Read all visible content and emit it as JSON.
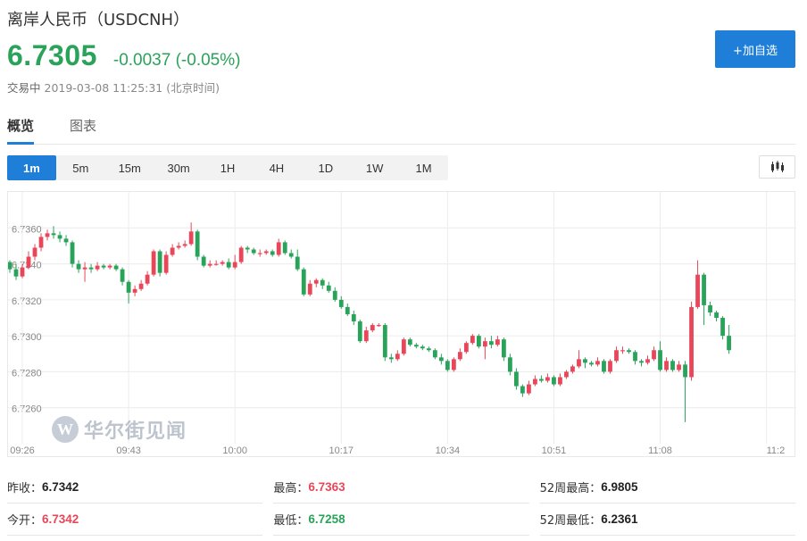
{
  "header": {
    "title": "离岸人民币（USDCNH）",
    "price": "6.7305",
    "change": "-0.0037 (-0.05%)",
    "status": "交易中",
    "timestamp": "2019-03-08 11:25:31 (北京时间)",
    "add_button": "+加自选"
  },
  "tabs": [
    {
      "label": "概览",
      "active": true
    },
    {
      "label": "图表",
      "active": false
    }
  ],
  "periods": [
    {
      "label": "1m",
      "active": true
    },
    {
      "label": "5m",
      "active": false
    },
    {
      "label": "15m",
      "active": false
    },
    {
      "label": "30m",
      "active": false
    },
    {
      "label": "1H",
      "active": false
    },
    {
      "label": "4H",
      "active": false
    },
    {
      "label": "1D",
      "active": false
    },
    {
      "label": "1W",
      "active": false
    },
    {
      "label": "1M",
      "active": false
    }
  ],
  "watermark": {
    "logo": "W",
    "text": "华尔街见闻"
  },
  "colors": {
    "up": "#e8475a",
    "down": "#2aa35a",
    "accent": "#1e7ed8",
    "grid": "#ececec"
  },
  "chart_data": {
    "type": "candlestick",
    "ylim": [
      6.724,
      6.738
    ],
    "y_ticks": [
      "6.7360",
      "6.7340",
      "6.7320",
      "6.7300",
      "6.7280",
      "6.7260"
    ],
    "y_tick_values": [
      6.736,
      6.734,
      6.732,
      6.73,
      6.728,
      6.726
    ],
    "x_ticks": [
      "09:26",
      "09:43",
      "10:00",
      "10:17",
      "10:34",
      "10:51",
      "11:08",
      "11:2"
    ],
    "x_tick_index": [
      2,
      19,
      36,
      53,
      70,
      87,
      104,
      121
    ],
    "grid": true,
    "candles": [
      [
        6.7341,
        6.7337,
        6.7342,
        6.7335
      ],
      [
        6.7337,
        6.7333,
        6.734,
        6.7331
      ],
      [
        6.7333,
        6.7338,
        6.734,
        6.7332
      ],
      [
        6.7338,
        6.7344,
        6.7347,
        6.7337
      ],
      [
        6.7344,
        6.7349,
        6.7351,
        6.7342
      ],
      [
        6.7349,
        6.7355,
        6.7357,
        6.7347
      ],
      [
        6.7355,
        6.7357,
        6.7359,
        6.7353
      ],
      [
        6.7357,
        6.7356,
        6.7361,
        6.7354
      ],
      [
        6.7356,
        6.7354,
        6.7358,
        6.7352
      ],
      [
        6.7354,
        6.7352,
        6.7356,
        6.735
      ],
      [
        6.7352,
        6.734,
        6.7353,
        6.7338
      ],
      [
        6.734,
        6.7337,
        6.7342,
        6.7335
      ],
      [
        6.7337,
        6.7338,
        6.7341,
        6.733
      ],
      [
        6.7338,
        6.7337,
        6.734,
        6.7335
      ],
      [
        6.7337,
        6.7339,
        6.7341,
        6.7336
      ],
      [
        6.7339,
        6.7338,
        6.734,
        6.7337
      ],
      [
        6.7338,
        6.7339,
        6.734,
        6.7337
      ],
      [
        6.7339,
        6.7337,
        6.734,
        6.7336
      ],
      [
        6.7337,
        6.733,
        6.7338,
        6.7328
      ],
      [
        6.733,
        6.7324,
        6.7331,
        6.7318
      ],
      [
        6.7324,
        6.7326,
        6.7328,
        6.7322
      ],
      [
        6.7326,
        6.7329,
        6.7331,
        6.7325
      ],
      [
        6.7329,
        6.7334,
        6.7336,
        6.7328
      ],
      [
        6.7334,
        6.7347,
        6.7348,
        6.7333
      ],
      [
        6.7347,
        6.7335,
        6.7348,
        6.7333
      ],
      [
        6.7335,
        6.7345,
        6.7347,
        6.7334
      ],
      [
        6.7345,
        6.7349,
        6.7351,
        6.7344
      ],
      [
        6.7349,
        6.735,
        6.7352,
        6.7348
      ],
      [
        6.735,
        6.7351,
        6.7353,
        6.7349
      ],
      [
        6.7351,
        6.7358,
        6.7363,
        6.735
      ],
      [
        6.7358,
        6.7344,
        6.7359,
        6.7342
      ],
      [
        6.7344,
        6.7339,
        6.7345,
        6.7338
      ],
      [
        6.7339,
        6.734,
        6.7342,
        6.7338
      ],
      [
        6.734,
        6.734,
        6.7342,
        6.7339
      ],
      [
        6.734,
        6.7341,
        6.7342,
        6.7339
      ],
      [
        6.7341,
        6.7338,
        6.7343,
        6.7337
      ],
      [
        6.7338,
        6.7341,
        6.7345,
        6.7337
      ],
      [
        6.7341,
        6.7349,
        6.735,
        6.734
      ],
      [
        6.7349,
        6.7348,
        6.735,
        6.7346
      ],
      [
        6.7348,
        6.7346,
        6.7349,
        6.7345
      ],
      [
        6.7346,
        6.7346,
        6.7348,
        6.7344
      ],
      [
        6.7346,
        6.7347,
        6.7348,
        6.7345
      ],
      [
        6.7347,
        6.7345,
        6.7348,
        6.7344
      ],
      [
        6.7345,
        6.7352,
        6.7354,
        6.7344
      ],
      [
        6.7352,
        6.7346,
        6.7353,
        6.7345
      ],
      [
        6.7346,
        6.7344,
        6.7348,
        6.7343
      ],
      [
        6.7344,
        6.7337,
        6.7348,
        6.7336
      ],
      [
        6.7337,
        6.7323,
        6.7338,
        6.7322
      ],
      [
        6.7323,
        6.7329,
        6.7331,
        6.7322
      ],
      [
        6.7329,
        6.7331,
        6.7332,
        6.7327
      ],
      [
        6.7331,
        6.7328,
        6.7332,
        6.7326
      ],
      [
        6.7328,
        6.7325,
        6.733,
        6.7324
      ],
      [
        6.7325,
        6.732,
        6.7327,
        6.7319
      ],
      [
        6.732,
        6.7316,
        6.7322,
        6.7315
      ],
      [
        6.7316,
        6.7312,
        6.7318,
        6.7311
      ],
      [
        6.7312,
        6.7308,
        6.7314,
        6.7306
      ],
      [
        6.7308,
        6.7297,
        6.7309,
        6.7296
      ],
      [
        6.7297,
        6.7303,
        6.7305,
        6.7296
      ],
      [
        6.7303,
        6.7306,
        6.7307,
        6.7302
      ],
      [
        6.7306,
        6.7306,
        6.7307,
        6.7305
      ],
      [
        6.7306,
        6.7288,
        6.7307,
        6.7286
      ],
      [
        6.7288,
        6.7287,
        6.729,
        6.7285
      ],
      [
        6.7287,
        6.729,
        6.7292,
        6.7286
      ],
      [
        6.729,
        6.7298,
        6.7299,
        6.7289
      ],
      [
        6.7298,
        6.7295,
        6.7299,
        6.7294
      ],
      [
        6.7295,
        6.7294,
        6.7296,
        6.7293
      ],
      [
        6.7294,
        6.7293,
        6.7295,
        6.7292
      ],
      [
        6.7293,
        6.7292,
        6.7294,
        6.7291
      ],
      [
        6.7292,
        6.7288,
        6.7293,
        6.7287
      ],
      [
        6.7288,
        6.7286,
        6.729,
        6.7284
      ],
      [
        6.7286,
        6.7281,
        6.7287,
        6.728
      ],
      [
        6.7281,
        6.7287,
        6.7288,
        6.728
      ],
      [
        6.7287,
        6.7291,
        6.7293,
        6.7286
      ],
      [
        6.7291,
        6.7296,
        6.7297,
        6.729
      ],
      [
        6.7296,
        6.73,
        6.7301,
        6.7295
      ],
      [
        6.73,
        6.7294,
        6.7301,
        6.7293
      ],
      [
        6.7294,
        6.7297,
        6.7299,
        6.7287
      ],
      [
        6.7297,
        6.7295,
        6.73,
        6.7293
      ],
      [
        6.7295,
        6.7298,
        6.73,
        6.7294
      ],
      [
        6.7298,
        6.7288,
        6.7299,
        6.7286
      ],
      [
        6.7288,
        6.728,
        6.729,
        6.7278
      ],
      [
        6.728,
        6.7272,
        6.7282,
        6.727
      ],
      [
        6.7272,
        6.7268,
        6.7273,
        6.7266
      ],
      [
        6.7268,
        6.7273,
        6.7275,
        6.7267
      ],
      [
        6.7273,
        6.7276,
        6.7278,
        6.7272
      ],
      [
        6.7276,
        6.7275,
        6.7278,
        6.7274
      ],
      [
        6.7275,
        6.7277,
        6.7279,
        6.7274
      ],
      [
        6.7277,
        6.7273,
        6.7278,
        6.7272
      ],
      [
        6.7273,
        6.7277,
        6.7279,
        6.7272
      ],
      [
        6.7277,
        6.728,
        6.7281,
        6.7276
      ],
      [
        6.728,
        6.7283,
        6.7284,
        6.7279
      ],
      [
        6.7283,
        6.7287,
        6.7292,
        6.7282
      ],
      [
        6.7287,
        6.7285,
        6.7288,
        6.7282
      ],
      [
        6.7285,
        6.7284,
        6.7286,
        6.7283
      ],
      [
        6.7284,
        6.7286,
        6.7288,
        6.7283
      ],
      [
        6.7286,
        6.728,
        6.7287,
        6.7279
      ],
      [
        6.728,
        6.7286,
        6.7287,
        6.7279
      ],
      [
        6.7286,
        6.7292,
        6.7294,
        6.7285
      ],
      [
        6.7292,
        6.7292,
        6.7294,
        6.729
      ],
      [
        6.7292,
        6.7291,
        6.7293,
        6.729
      ],
      [
        6.7291,
        6.7286,
        6.7292,
        6.7284
      ],
      [
        6.7286,
        6.7285,
        6.7287,
        6.7283
      ],
      [
        6.7285,
        6.7287,
        6.7289,
        6.7284
      ],
      [
        6.7287,
        6.7292,
        6.7294,
        6.7286
      ],
      [
        6.7292,
        6.7281,
        6.7297,
        6.728
      ],
      [
        6.7281,
        6.7286,
        6.7288,
        6.728
      ],
      [
        6.7286,
        6.7281,
        6.7287,
        6.728
      ],
      [
        6.7281,
        6.7284,
        6.7286,
        6.728
      ],
      [
        6.7284,
        6.7277,
        6.7286,
        6.7252
      ],
      [
        6.7277,
        6.7316,
        6.7319,
        6.7275
      ],
      [
        6.7316,
        6.7334,
        6.7342,
        6.7315
      ],
      [
        6.7334,
        6.7317,
        6.7335,
        6.7306
      ],
      [
        6.7317,
        6.7313,
        6.7319,
        6.7311
      ],
      [
        6.7313,
        6.731,
        6.7314,
        6.7308
      ],
      [
        6.731,
        6.73,
        6.7311,
        6.7298
      ],
      [
        6.73,
        6.7292,
        6.7306,
        6.729
      ]
    ]
  },
  "stats": [
    [
      {
        "label": "昨收：",
        "value": "6.7342",
        "tone": "neutral"
      },
      {
        "label": "最高：",
        "value": "6.7363",
        "tone": "red"
      },
      {
        "label": "52周最高：",
        "value": "6.9805",
        "tone": "neutral"
      }
    ],
    [
      {
        "label": "今开：",
        "value": "6.7342",
        "tone": "red"
      },
      {
        "label": "最低：",
        "value": "6.7258",
        "tone": "green"
      },
      {
        "label": "52周最低：",
        "value": "6.2361",
        "tone": "neutral"
      }
    ]
  ]
}
